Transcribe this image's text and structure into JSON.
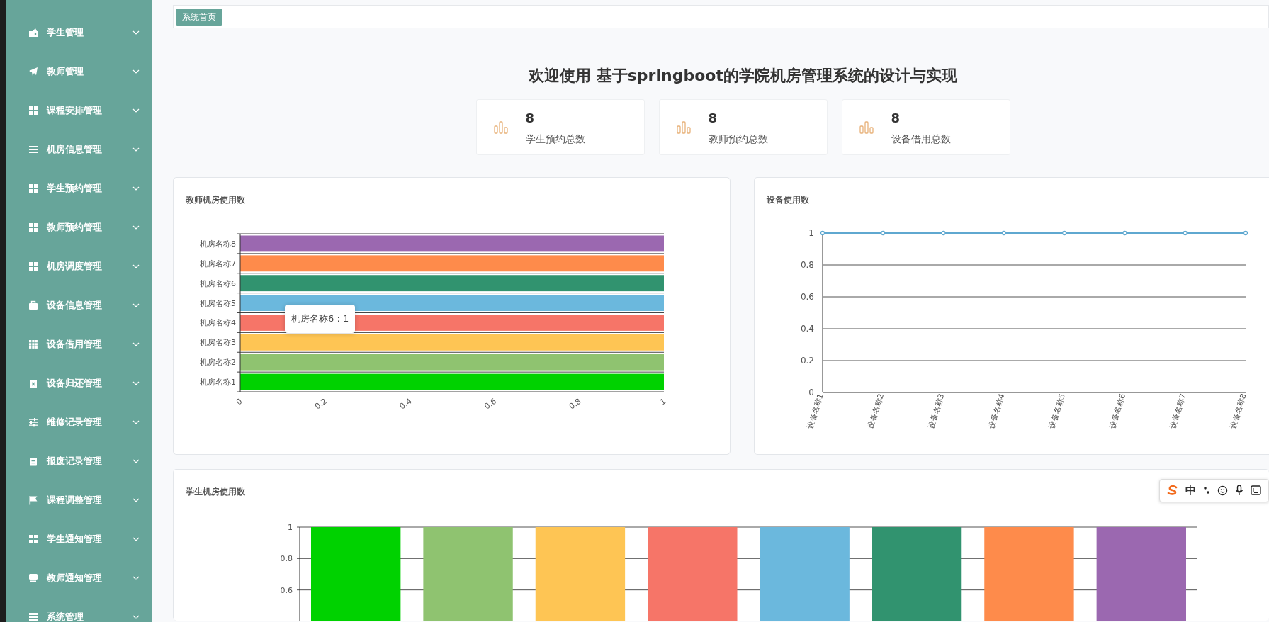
{
  "sidebar": {
    "items": [
      {
        "label": "学生管理"
      },
      {
        "label": "教师管理"
      },
      {
        "label": "课程安排管理"
      },
      {
        "label": "机房信息管理"
      },
      {
        "label": "学生预约管理"
      },
      {
        "label": "教师预约管理"
      },
      {
        "label": "机房调度管理"
      },
      {
        "label": "设备信息管理"
      },
      {
        "label": "设备借用管理"
      },
      {
        "label": "设备归还管理"
      },
      {
        "label": "维修记录管理"
      },
      {
        "label": "报废记录管理"
      },
      {
        "label": "课程调整管理"
      },
      {
        "label": "学生通知管理"
      },
      {
        "label": "教师通知管理"
      },
      {
        "label": "系统管理"
      }
    ]
  },
  "breadcrumb": {
    "tag": "系统首页"
  },
  "welcome_title": "欢迎使用 基于springboot的学院机房管理系统的设计与实现",
  "stats": [
    {
      "value": "8",
      "label": "学生预约总数"
    },
    {
      "value": "8",
      "label": "教师预约总数"
    },
    {
      "value": "8",
      "label": "设备借用总数"
    }
  ],
  "teacher_room_chart": {
    "title": "教师机房使用数",
    "tooltip": "机房名称6 : 1",
    "chart_data": {
      "type": "bar",
      "orientation": "horizontal",
      "categories": [
        "机房名称8",
        "机房名称7",
        "机房名称6",
        "机房名称5",
        "机房名称4",
        "机房名称3",
        "机房名称2",
        "机房名称1"
      ],
      "values": [
        1,
        1,
        1,
        1,
        1,
        1,
        1,
        1
      ],
      "colors": [
        "#9b68b0",
        "#fe8b4b",
        "#31936f",
        "#6bb8dd",
        "#f67568",
        "#fec554",
        "#8fc370",
        "#00d200"
      ],
      "xlim": [
        0,
        1
      ],
      "xticks": [
        0,
        0.2,
        0.4,
        0.6,
        0.8,
        1
      ]
    }
  },
  "device_chart": {
    "title": "设备使用数",
    "chart_data": {
      "type": "line",
      "categories": [
        "设备名称1",
        "设备名称2",
        "设备名称3",
        "设备名称4",
        "设备名称5",
        "设备名称6",
        "设备名称7",
        "设备名称8"
      ],
      "values": [
        1,
        1,
        1,
        1,
        1,
        1,
        1,
        1
      ],
      "ylim": [
        0,
        1
      ],
      "yticks": [
        0,
        0.2,
        0.4,
        0.6,
        0.8,
        1
      ],
      "grid": true,
      "marker": true
    }
  },
  "student_room_chart": {
    "title": "学生机房使用数",
    "chart_data": {
      "type": "bar",
      "values": [
        1,
        1,
        1,
        1,
        1,
        1,
        1,
        1
      ],
      "colors": [
        "#00d200",
        "#8fc370",
        "#fec554",
        "#f67568",
        "#6bb8dd",
        "#31936f",
        "#fe8b4b",
        "#9b68b0"
      ],
      "ylim": [
        0.4,
        1
      ],
      "yticks": [
        0.6,
        0.8,
        1
      ],
      "grid": true
    }
  },
  "ime_toolbar": {
    "mode": "中"
  }
}
